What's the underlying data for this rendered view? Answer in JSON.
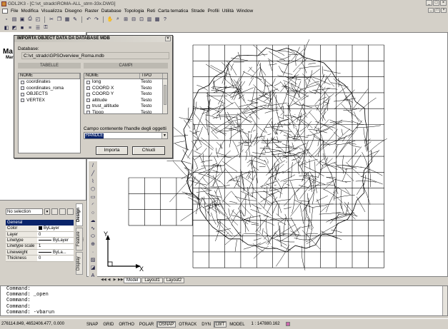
{
  "window": {
    "title": "GDL2K3 - [C:\\vt_stradc\\ROMA-ALL_strm-33x.DWG]",
    "controls": [
      "_",
      "□",
      "×"
    ]
  },
  "menu": {
    "items": [
      "File",
      "Modifica",
      "Visualizza",
      "Disegno",
      "Raster",
      "Database",
      "Topologia",
      "Reti",
      "Carta tematica",
      "Strade",
      "Profili",
      "Utilità",
      "Window"
    ]
  },
  "toolbars": {
    "row1": [
      "new-icon",
      "open-icon",
      "save-icon",
      "print-icon",
      "preview-icon",
      "cut-icon",
      "copy-icon",
      "paste-icon",
      "match-icon",
      "undo-icon",
      "redo-icon",
      "pan-icon",
      "zoom-realtime-icon",
      "zoom-window-icon",
      "zoom-previous-icon",
      "zoom-extents-icon",
      "properties-icon",
      "design-center-icon",
      "help-icon"
    ],
    "row1_glyphs": [
      "▫",
      "▤",
      "▣",
      "⎙",
      "◰",
      "✂",
      "❐",
      "▦",
      "✎",
      "↶",
      "↷",
      "✋",
      "⌕",
      "⊞",
      "⊟",
      "⊡",
      "▥",
      "▩",
      "?"
    ],
    "row2": [
      "layer-icon",
      "layer-state-icon",
      "color-icon",
      "linetype-icon",
      "lineweight-icon",
      "layer-lock-icon"
    ],
    "row2_glyphs": [
      "◧",
      "◩",
      "■",
      "≡",
      "☰",
      "⚿"
    ]
  },
  "left_panel": {
    "title": "Ma",
    "subtitle": "Mar"
  },
  "dialog": {
    "title": "IMPORTA OBJECT DATA DA DATABASE MDB",
    "close": "×",
    "database_label": "Database:",
    "database_path": "C:\\vt_stradc\\GPSOverview_Roma.mdb",
    "tables_label": "TABELLE",
    "fields_label": "CAMPI",
    "tables_header": "NOME",
    "tables": [
      "coordinates",
      "coordinates_roma",
      "OBJECTS",
      "VERTEX"
    ],
    "fields_header_name": "NOME",
    "fields_header_type": "TIPO",
    "fields": [
      {
        "name": "long",
        "type": "Testo"
      },
      {
        "name": "COORD X",
        "type": "Testo"
      },
      {
        "name": "COORD Y",
        "type": "Testo"
      },
      {
        "name": "altitude",
        "type": "Testo"
      },
      {
        "name": "trust_altitude",
        "type": "Testo"
      },
      {
        "name": "Tipop",
        "type": "Testo"
      }
    ],
    "handle_label": "Campo contenente l'handle degli oggetti",
    "handle_value": "HANDLE",
    "import_button": "Importa",
    "close_button": "Chiudi"
  },
  "properties": {
    "selection": "No selection",
    "group": "General",
    "rows": [
      {
        "key": "Color",
        "value": "ByLayer",
        "kind": "color"
      },
      {
        "key": "Layer",
        "value": "0",
        "kind": "text"
      },
      {
        "key": "Linetype",
        "value": "ByLayer",
        "kind": "line"
      },
      {
        "key": "Linetype scale",
        "value": "1",
        "kind": "text"
      },
      {
        "key": "Lineweight",
        "value": "ByLa...",
        "kind": "line"
      },
      {
        "key": "Thickness",
        "value": "0",
        "kind": "text"
      }
    ],
    "side_tabs": [
      "Design",
      "Feature ...",
      "Display"
    ]
  },
  "draw_toolbar": [
    "line-icon",
    "construction-line-icon",
    "polyline-icon",
    "polygon-icon",
    "rectangle-icon",
    "arc-icon",
    "circle-icon",
    "revision-cloud-icon",
    "spline-icon",
    "ellipse-icon",
    "insert-block-icon",
    "point-icon",
    "hatch-icon",
    "region-icon",
    "text-icon"
  ],
  "draw_toolbar_glyphs": [
    "/",
    "╱",
    "⌇",
    "⬡",
    "▭",
    "◜",
    "○",
    "☁",
    "∿",
    "⬭",
    "⊕",
    "·",
    "▨",
    "◪",
    "A"
  ],
  "ucs": {
    "x_label": "X",
    "y_label": "Y"
  },
  "layout_tabs": [
    "Model",
    "Layout1",
    "Layout2"
  ],
  "layout_nav": [
    "◀◀",
    "◀",
    "▶",
    "▶▶"
  ],
  "command_lines": [
    "Command:",
    "Command: _open",
    "Command:",
    "Command:",
    "Command: -vbarun"
  ],
  "status": {
    "coords": "276114.849, 4652406.477, 0.000",
    "toggles": [
      {
        "label": "SNAP",
        "on": false
      },
      {
        "label": "GRID",
        "on": false
      },
      {
        "label": "ORTHO",
        "on": false
      },
      {
        "label": "POLAR",
        "on": false
      },
      {
        "label": "OSNAP",
        "on": true
      },
      {
        "label": "OTRACK",
        "on": false
      },
      {
        "label": "DYN",
        "on": false
      },
      {
        "label": "LWT",
        "on": true
      },
      {
        "label": "MODEL",
        "on": false
      }
    ],
    "scale": "1 : 147880.162"
  },
  "colors": {
    "selection_blue": "#0a246a",
    "chrome": "#d4d0c8",
    "canvas": "#ffffff"
  }
}
